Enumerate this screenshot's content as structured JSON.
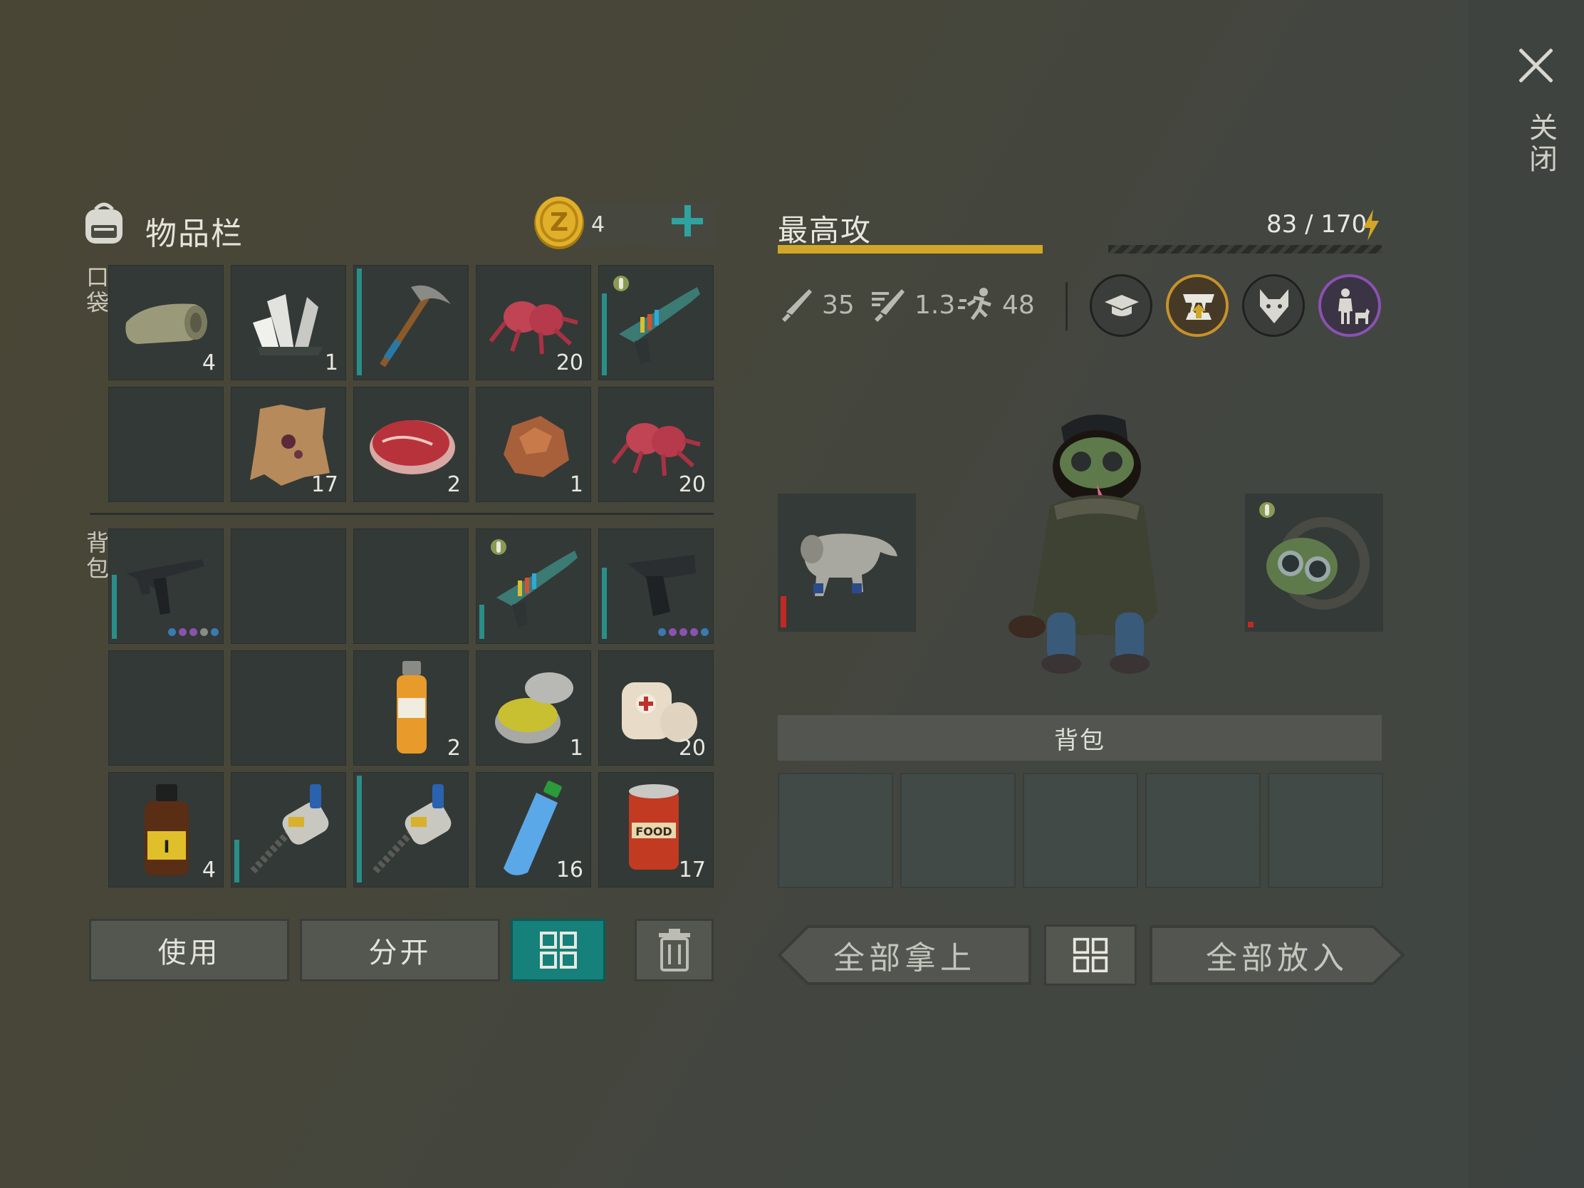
{
  "close_label": "关闭",
  "inventory": {
    "title": "物品栏",
    "coins": "4",
    "pocket_label": "口袋",
    "backpack_label": "背包",
    "pocket_slots": [
      {
        "item": "fabric-roll-icon",
        "count": "4"
      },
      {
        "item": "crystals-icon",
        "count": "1"
      },
      {
        "item": "pickaxe-icon",
        "count": ""
      },
      {
        "item": "mutant-flesh-icon",
        "count": "20"
      },
      {
        "item": "blaster-icon",
        "count": ""
      },
      {
        "item": "",
        "count": ""
      },
      {
        "item": "hide-icon",
        "count": "17"
      },
      {
        "item": "steak-icon",
        "count": "2"
      },
      {
        "item": "ore-icon",
        "count": "1"
      },
      {
        "item": "mutant-flesh-icon",
        "count": "20"
      }
    ],
    "backpack_slots": [
      {
        "item": "smg-icon",
        "count": ""
      },
      {
        "item": "",
        "count": ""
      },
      {
        "item": "",
        "count": ""
      },
      {
        "item": "blaster-icon",
        "count": ""
      },
      {
        "item": "pistol-icon",
        "count": ""
      },
      {
        "item": "",
        "count": ""
      },
      {
        "item": "",
        "count": ""
      },
      {
        "item": "pesticide-bottle-icon",
        "count": "2"
      },
      {
        "item": "ointment-tin-icon",
        "count": "1"
      },
      {
        "item": "bandage-icon",
        "count": "20"
      },
      {
        "item": "medicine-bottle-icon",
        "count": "4"
      },
      {
        "item": "drill-icon",
        "count": ""
      },
      {
        "item": "drill-icon",
        "count": ""
      },
      {
        "item": "water-bottle-icon",
        "count": "16"
      },
      {
        "item": "canned-food-icon",
        "count": "17"
      }
    ],
    "buttons": {
      "use": "使用",
      "split": "分开"
    }
  },
  "pet": {
    "name": "最高攻",
    "energy": "83 / 170",
    "energy_fraction": 0.488,
    "stats": {
      "attack": "35",
      "attack_speed": "1.3",
      "speed": "48"
    },
    "abilities": [
      "graduation-cap-icon",
      "fangs-upgrade-icon",
      "wolf-head-icon",
      "person-with-dog-icon"
    ],
    "equipment": [
      "dog-suit-icon",
      "gas-mask-icon"
    ],
    "backpack_label": "背包",
    "buttons": {
      "take_all": "全部拿上",
      "put_all": "全部放入"
    }
  },
  "colors": {
    "accent": "#16807a",
    "gold": "#d2a628",
    "durability": "#2a8e88",
    "danger": "#c02a24"
  }
}
